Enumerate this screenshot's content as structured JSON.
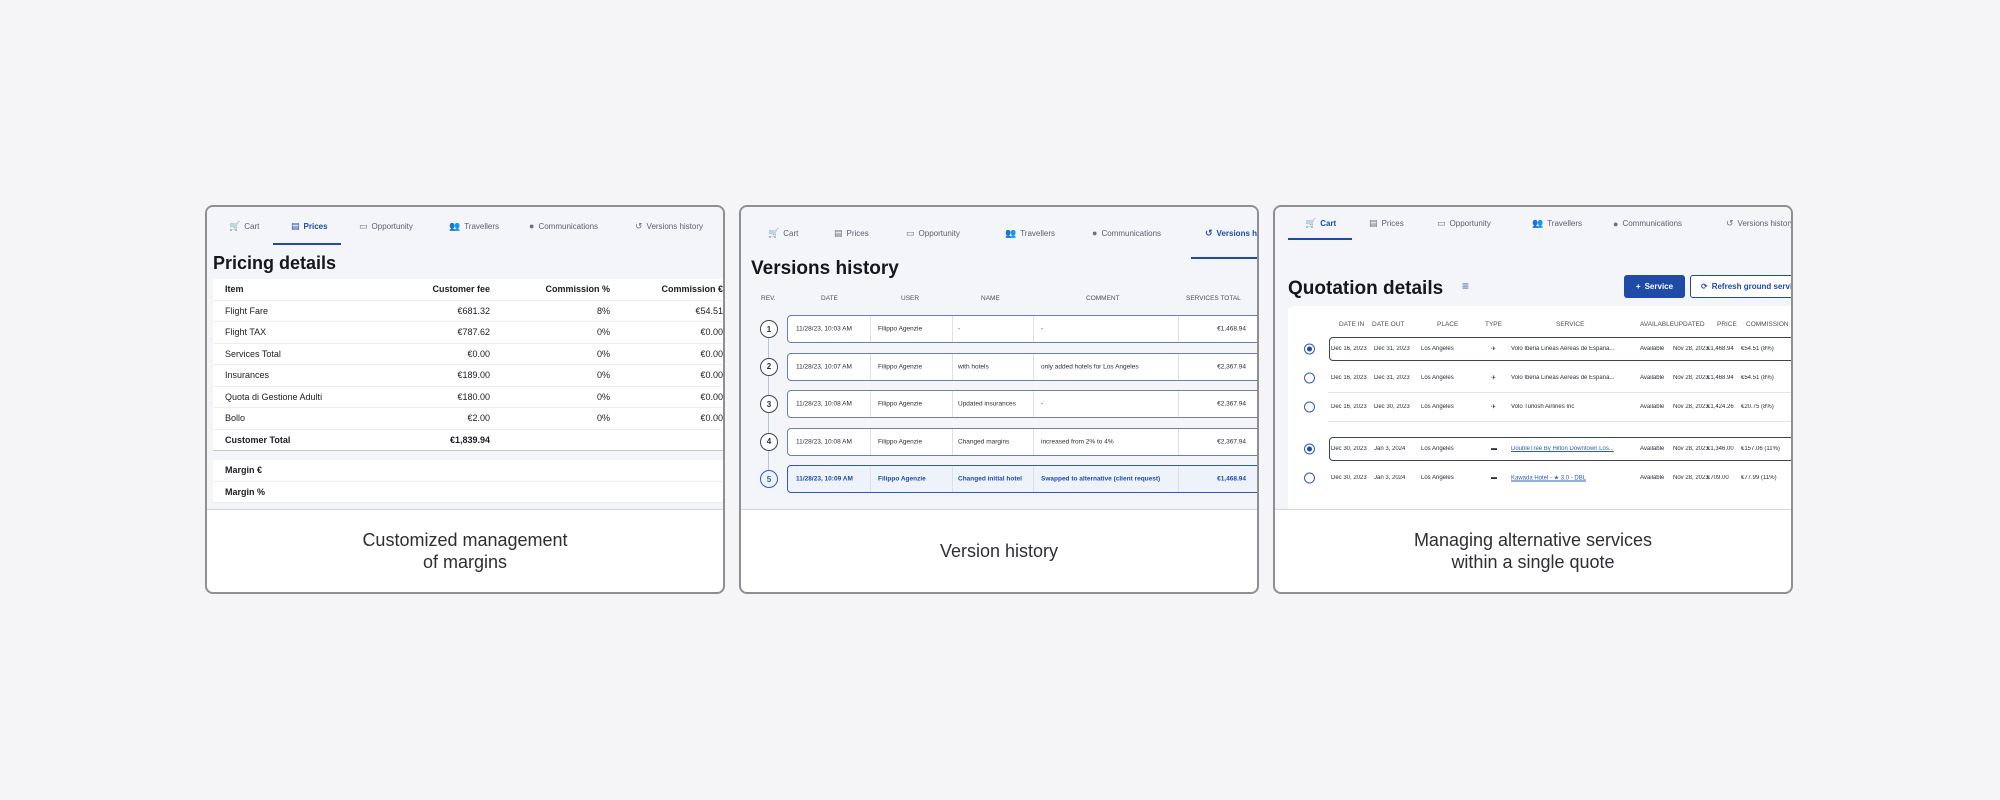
{
  "cards": [
    {
      "caption": "Customized management\nof margins",
      "tabs": [
        {
          "label": "Cart",
          "icon": "cart-icon",
          "glyph": "🛒"
        },
        {
          "label": "Prices",
          "icon": "receipt-icon",
          "glyph": "▤",
          "active": true
        },
        {
          "label": "Opportunity",
          "icon": "folder-icon",
          "glyph": "▭"
        },
        {
          "label": "Travellers",
          "icon": "users-icon",
          "glyph": "👥"
        },
        {
          "label": "Communications",
          "icon": "chat-icon",
          "glyph": "●"
        },
        {
          "label": "Versions history",
          "icon": "history-icon",
          "glyph": "↺"
        }
      ],
      "title": "Pricing details",
      "table": {
        "headers": [
          "Item",
          "Customer fee",
          "Commission %",
          "Commission €"
        ],
        "rows": [
          [
            "Flight Fare",
            "€681.32",
            "8%",
            "€54.51"
          ],
          [
            "Flight TAX",
            "€787.62",
            "0%",
            "€0.00"
          ],
          [
            "Services Total",
            "€0.00",
            "0%",
            "€0.00"
          ],
          [
            "Insurances",
            "€189.00",
            "0%",
            "€0.00"
          ],
          [
            "Quota di Gestione Adulti",
            "€180.00",
            "0%",
            "€0.00"
          ],
          [
            "Bollo",
            "€2.00",
            "0%",
            "€0.00"
          ]
        ],
        "total": [
          "Customer Total",
          "€1,839.94"
        ],
        "margins": [
          "Margin €",
          "Margin %"
        ]
      }
    },
    {
      "caption": "Version history",
      "tabs": [
        {
          "label": "Cart",
          "icon": "cart-icon",
          "glyph": "🛒"
        },
        {
          "label": "Prices",
          "icon": "receipt-icon",
          "glyph": "▤"
        },
        {
          "label": "Opportunity",
          "icon": "folder-icon",
          "glyph": "▭"
        },
        {
          "label": "Travellers",
          "icon": "users-icon",
          "glyph": "👥"
        },
        {
          "label": "Communications",
          "icon": "chat-icon",
          "glyph": "●"
        },
        {
          "label": "Versions hi",
          "icon": "history-icon",
          "glyph": "↺",
          "active": true
        }
      ],
      "title": "Versions history",
      "headers": [
        "REV.",
        "DATE",
        "USER",
        "NAME",
        "COMMENT",
        "SERVICES TOTAL"
      ],
      "rows": [
        {
          "rev": "1",
          "date": "11/28/23, 10:03 AM",
          "user": "Filippo Agenzie",
          "name": "-",
          "comment": "-",
          "total": "€1,468.94"
        },
        {
          "rev": "2",
          "date": "11/28/23, 10:07 AM",
          "user": "Filippo Agenzie",
          "name": "with hotels",
          "comment": "only added hotels for Los Angeles",
          "total": "€2,367.94"
        },
        {
          "rev": "3",
          "date": "11/28/23, 10:08 AM",
          "user": "Filippo Agenzie",
          "name": "Updated insurances",
          "comment": "-",
          "total": "€2,367.94"
        },
        {
          "rev": "4",
          "date": "11/28/23, 10:08 AM",
          "user": "Filippo Agenzie",
          "name": "Changed margins",
          "comment": "increased from 2% to 4%",
          "total": "€2,367.94"
        },
        {
          "rev": "5",
          "date": "11/28/23, 10:09 AM",
          "user": "Filippo Agenzie",
          "name": "Changed initial hotel",
          "comment": "Swapped to alternative (client request)",
          "total": "€1,468.94",
          "selected": true
        }
      ]
    },
    {
      "caption": "Managing alternative services\nwithin a single quote",
      "tabs": [
        {
          "label": "Cart",
          "icon": "cart-icon",
          "glyph": "🛒",
          "active": true
        },
        {
          "label": "Prices",
          "icon": "receipt-icon",
          "glyph": "▤"
        },
        {
          "label": "Opportunity",
          "icon": "folder-icon",
          "glyph": "▭"
        },
        {
          "label": "Travellers",
          "icon": "users-icon",
          "glyph": "👥"
        },
        {
          "label": "Communications",
          "icon": "chat-icon",
          "glyph": "●"
        },
        {
          "label": "Versions history",
          "icon": "history-icon",
          "glyph": "↺"
        }
      ],
      "title": "Quotation details",
      "buttons": {
        "service": "Service",
        "refresh": "Refresh ground services"
      },
      "headers": [
        "DATE IN",
        "DATE OUT",
        "PLACE",
        "TYPE",
        "SERVICE",
        "AVAILABLE",
        "UPDATED",
        "PRICE",
        "COMMISSION"
      ],
      "rows": [
        {
          "selected": true,
          "boxed": true,
          "date_in": "Dec 16, 2023",
          "date_out": "Dec 31, 2023",
          "place": "Los Angeles",
          "type": "flight",
          "type_glyph": "✈",
          "service": "Volo Iberia Lineas Aereas de Espana...",
          "available": "Available",
          "updated": "Nov 28, 2023",
          "price": "€1,468.94",
          "commission": "€54.51 (8%)"
        },
        {
          "selected": false,
          "date_in": "Dec 16, 2023",
          "date_out": "Dec 31, 2023",
          "place": "Los Angeles",
          "type": "flight",
          "type_glyph": "✈",
          "service": "Volo Iberia Lineas Aereas de Espana...",
          "available": "Available",
          "updated": "Nov 28, 2023",
          "price": "€1,468.94",
          "commission": "€54.51 (8%)"
        },
        {
          "selected": false,
          "date_in": "Dec 16, 2023",
          "date_out": "Dec 30, 2023",
          "place": "Los Angeles",
          "type": "flight",
          "type_glyph": "✈",
          "service": "Volo Turkish Airlines Inc",
          "available": "Available",
          "updated": "Nov 28, 2023",
          "price": "€1,424.26",
          "commission": "€20.75 (8%)"
        },
        {
          "selected": true,
          "boxed": true,
          "date_in": "Dec 30, 2023",
          "date_out": "Jan 3, 2024",
          "place": "Los Angeles",
          "type": "hotel",
          "type_glyph": "▬",
          "service": "DoubleTree By Hilton Downtown Los...",
          "link": true,
          "available": "Available",
          "updated": "Nov 28, 2023",
          "price": "€1,346.00",
          "commission": "€157.06 (11%)"
        },
        {
          "selected": false,
          "date_in": "Dec 30, 2023",
          "date_out": "Jan 3, 2024",
          "place": "Los Angeles",
          "type": "hotel",
          "type_glyph": "▬",
          "service": "Kawada Hotel - ★ 3.0 - DBL",
          "link": true,
          "available": "Available",
          "updated": "Nov 28, 2023",
          "price": "€709.00",
          "commission": "€77.99 (11%)"
        }
      ]
    }
  ],
  "colors": {
    "accent": "#1f4aa8",
    "background": "#f5f5f7",
    "card_border": "#8e8e93"
  }
}
